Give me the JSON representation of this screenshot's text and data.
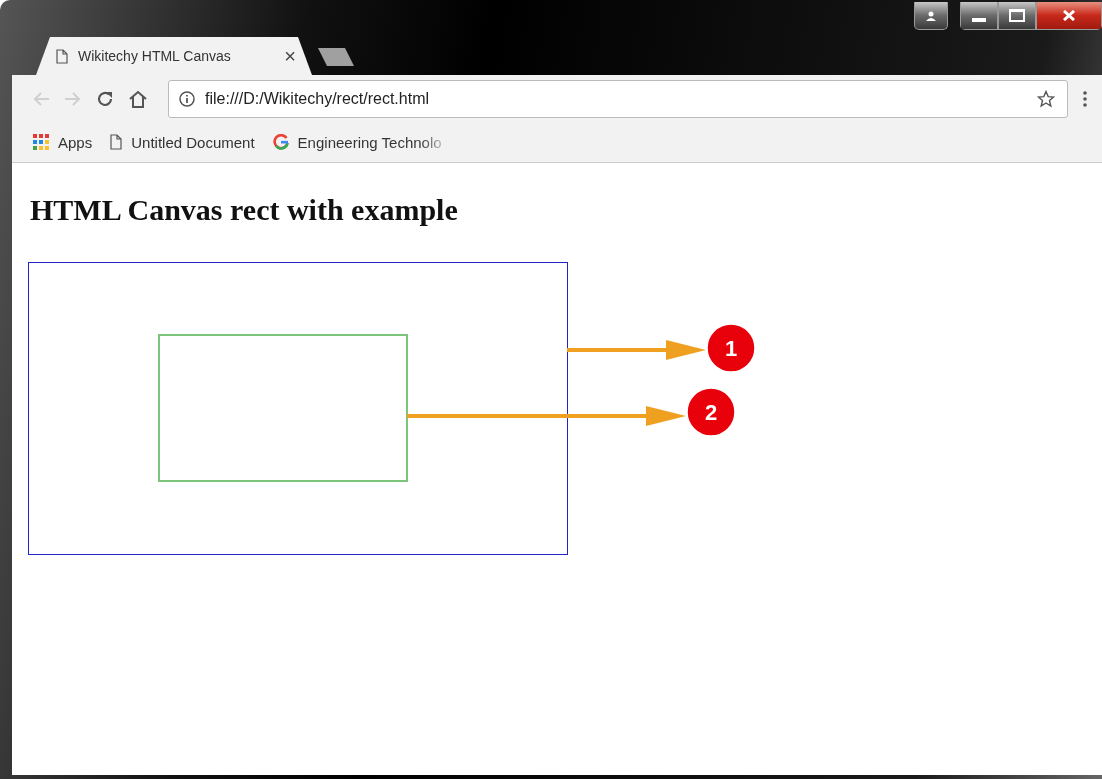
{
  "window": {
    "tab": {
      "title": "Wikitechy HTML Canvas",
      "close": "×",
      "selected": true
    }
  },
  "toolbar": {
    "url": "file:///D:/Wikitechy/rect/rect.html"
  },
  "bookmarks": [
    {
      "kind": "apps",
      "label": "Apps"
    },
    {
      "kind": "page",
      "label": "Untitled Document"
    },
    {
      "kind": "google",
      "label": "Engineering Technolo"
    }
  ],
  "page": {
    "heading": "HTML Canvas rect with example",
    "annotations": [
      {
        "label": "1"
      },
      {
        "label": "2"
      }
    ]
  }
}
